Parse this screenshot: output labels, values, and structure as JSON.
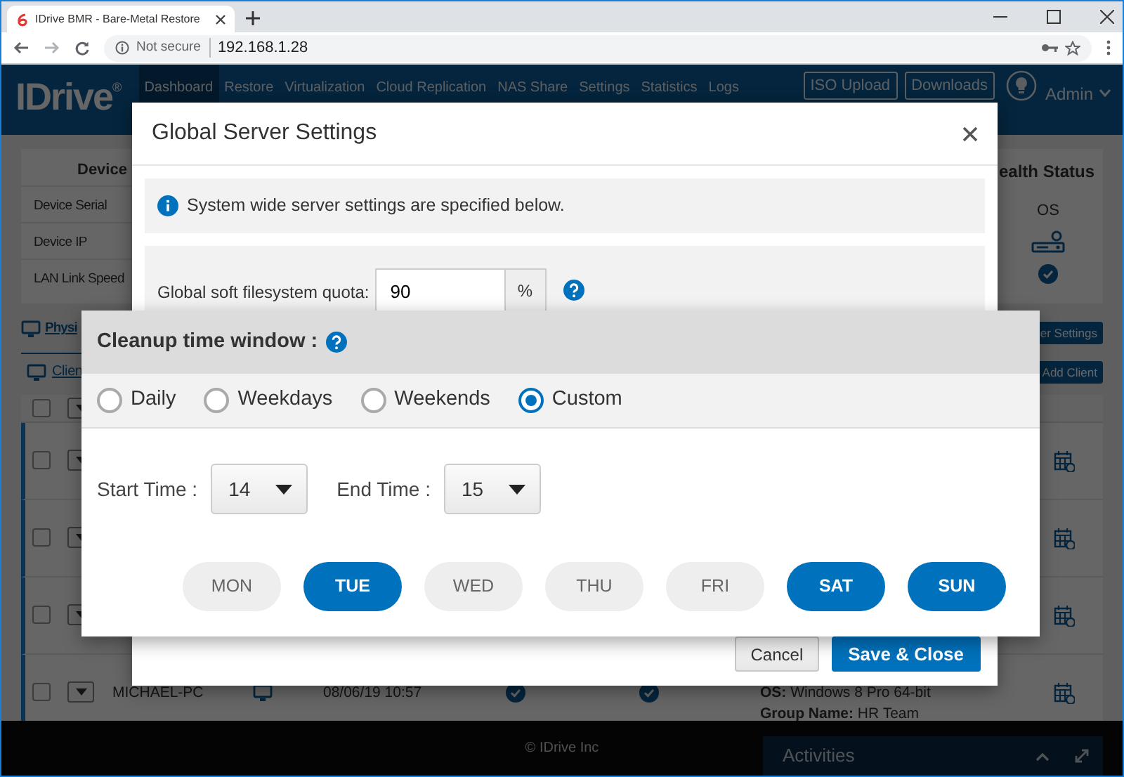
{
  "browser": {
    "tab_title": "IDrive BMR - Bare-Metal Restore",
    "security_label": "Not secure",
    "url": "192.168.1.28"
  },
  "navbar": {
    "logo": "IDrive",
    "logo_suffix": "®",
    "items": [
      {
        "label": "Dashboard",
        "selected": true
      },
      {
        "label": "Restore",
        "selected": false
      },
      {
        "label": "Virtualization",
        "selected": false
      },
      {
        "label": "Cloud Replication",
        "selected": false
      },
      {
        "label": "NAS Share",
        "selected": false
      },
      {
        "label": "Settings",
        "selected": false
      },
      {
        "label": "Statistics",
        "selected": false
      },
      {
        "label": "Logs",
        "selected": false
      }
    ],
    "buttons": [
      "ISO Upload",
      "Downloads"
    ],
    "user": "Admin"
  },
  "device_panel": {
    "title": "Device",
    "rows": [
      "Device Serial",
      "Device IP",
      "LAN Link Speed"
    ]
  },
  "health_panel": {
    "title": "ealth Status",
    "os_label": "OS"
  },
  "section_tab": "Physi",
  "client_tab": "Clien",
  "side_buttons": [
    "er Settings",
    "Add Client"
  ],
  "table_header": {
    "checked": false
  },
  "client_rows": [
    {
      "checked": false
    },
    {
      "checked": false
    },
    {
      "checked": false
    },
    {
      "checked": false,
      "name": "MICHAEL-PC",
      "date": "08/06/19 10:57",
      "os": "**OS:** Windows 8 Pro 64-bit",
      "group": "**Group Name:** HR Team"
    }
  ],
  "footer": {
    "copyright": "© IDrive Inc",
    "activities": "Activities"
  },
  "modal": {
    "title": "Global Server Settings",
    "info": "System wide server settings are specified below.",
    "quota_label": "Global soft filesystem quota:",
    "quota_value": "90",
    "quota_unit": "%",
    "buttons": [
      {
        "label": "Cancel",
        "kind": "secondary"
      },
      {
        "label": "Save & Close",
        "kind": "primary"
      }
    ]
  },
  "cleanup": {
    "title": "Cleanup time window :",
    "modes": [
      {
        "label": "Daily",
        "selected": false
      },
      {
        "label": "Weekdays",
        "selected": false
      },
      {
        "label": "Weekends",
        "selected": false
      },
      {
        "label": "Custom",
        "selected": true
      }
    ],
    "start_label": "Start Time :",
    "start": "14",
    "end_label": "End Time :",
    "end": "15",
    "days": [
      {
        "label": "MON",
        "selected": false
      },
      {
        "label": "TUE",
        "selected": true
      },
      {
        "label": "WED",
        "selected": false
      },
      {
        "label": "THU",
        "selected": false
      },
      {
        "label": "FRI",
        "selected": false
      },
      {
        "label": "SAT",
        "selected": true
      },
      {
        "label": "SUN",
        "selected": true
      }
    ]
  }
}
